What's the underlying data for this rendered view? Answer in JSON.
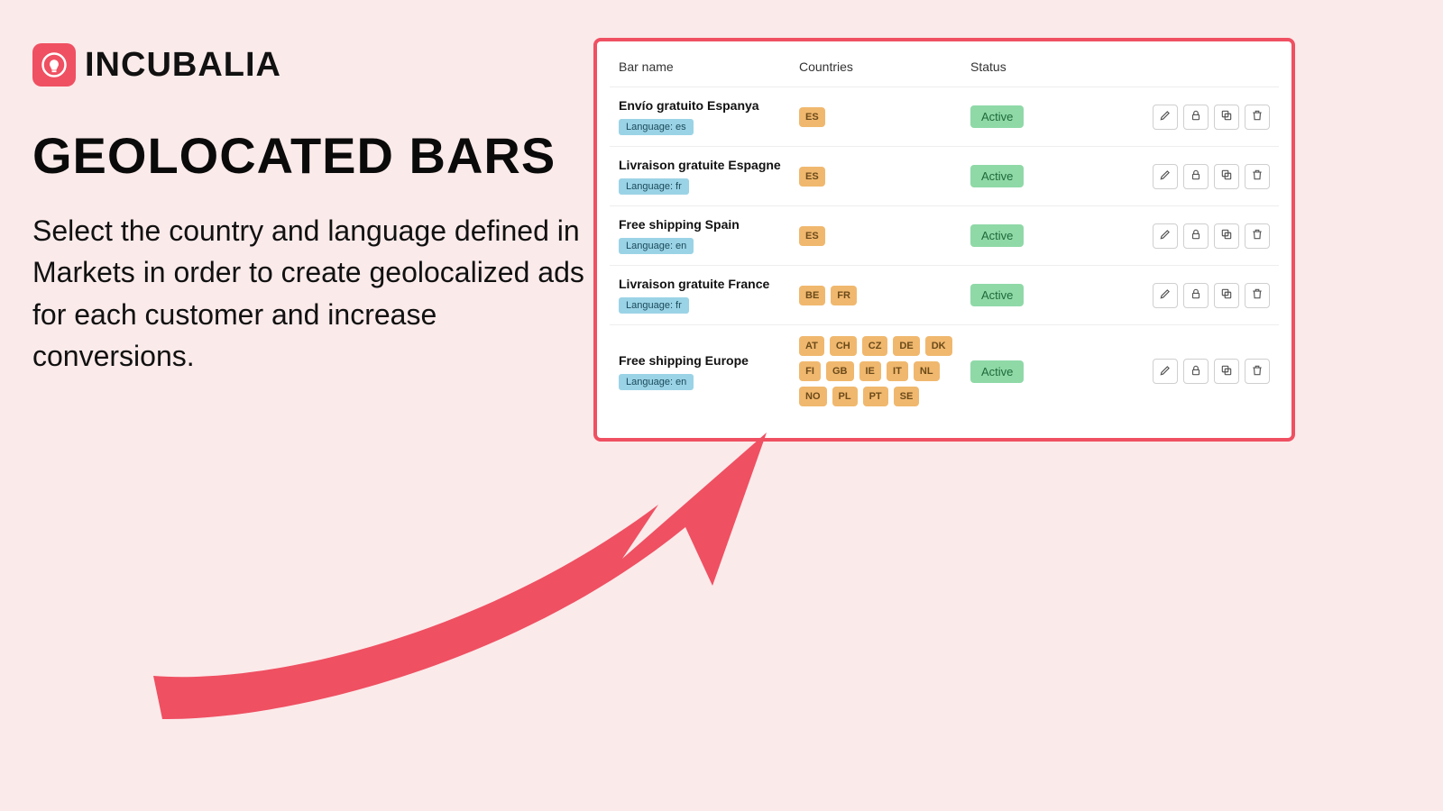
{
  "brand": "INCUBALIA",
  "title": "GEOLOCATED BARS",
  "description": "Select the country and language defined in Markets in order to create geolocalized ads for each customer and increase conversions.",
  "table": {
    "headers": {
      "bar_name": "Bar name",
      "countries": "Countries",
      "status": "Status"
    },
    "rows": [
      {
        "name": "Envío gratuito Espanya",
        "lang": "Language: es",
        "countries": [
          "ES"
        ],
        "status": "Active"
      },
      {
        "name": "Livraison gratuite Espagne",
        "lang": "Language: fr",
        "countries": [
          "ES"
        ],
        "status": "Active"
      },
      {
        "name": "Free shipping Spain",
        "lang": "Language: en",
        "countries": [
          "ES"
        ],
        "status": "Active"
      },
      {
        "name": "Livraison gratuite France",
        "lang": "Language: fr",
        "countries": [
          "BE",
          "FR"
        ],
        "status": "Active"
      },
      {
        "name": "Free shipping Europe",
        "lang": "Language: en",
        "countries": [
          "AT",
          "CH",
          "CZ",
          "DE",
          "DK",
          "FI",
          "GB",
          "IE",
          "IT",
          "NL",
          "NO",
          "PL",
          "PT",
          "SE"
        ],
        "status": "Active"
      }
    ]
  },
  "actions": {
    "edit": "edit",
    "lock": "lock",
    "copy": "copy",
    "delete": "delete"
  },
  "colors": {
    "accent": "#ef5062",
    "bg": "#fbeaea",
    "country_chip": "#f0b86e",
    "lang_chip": "#9bd3e6",
    "status_pill": "#8fd9a7"
  }
}
